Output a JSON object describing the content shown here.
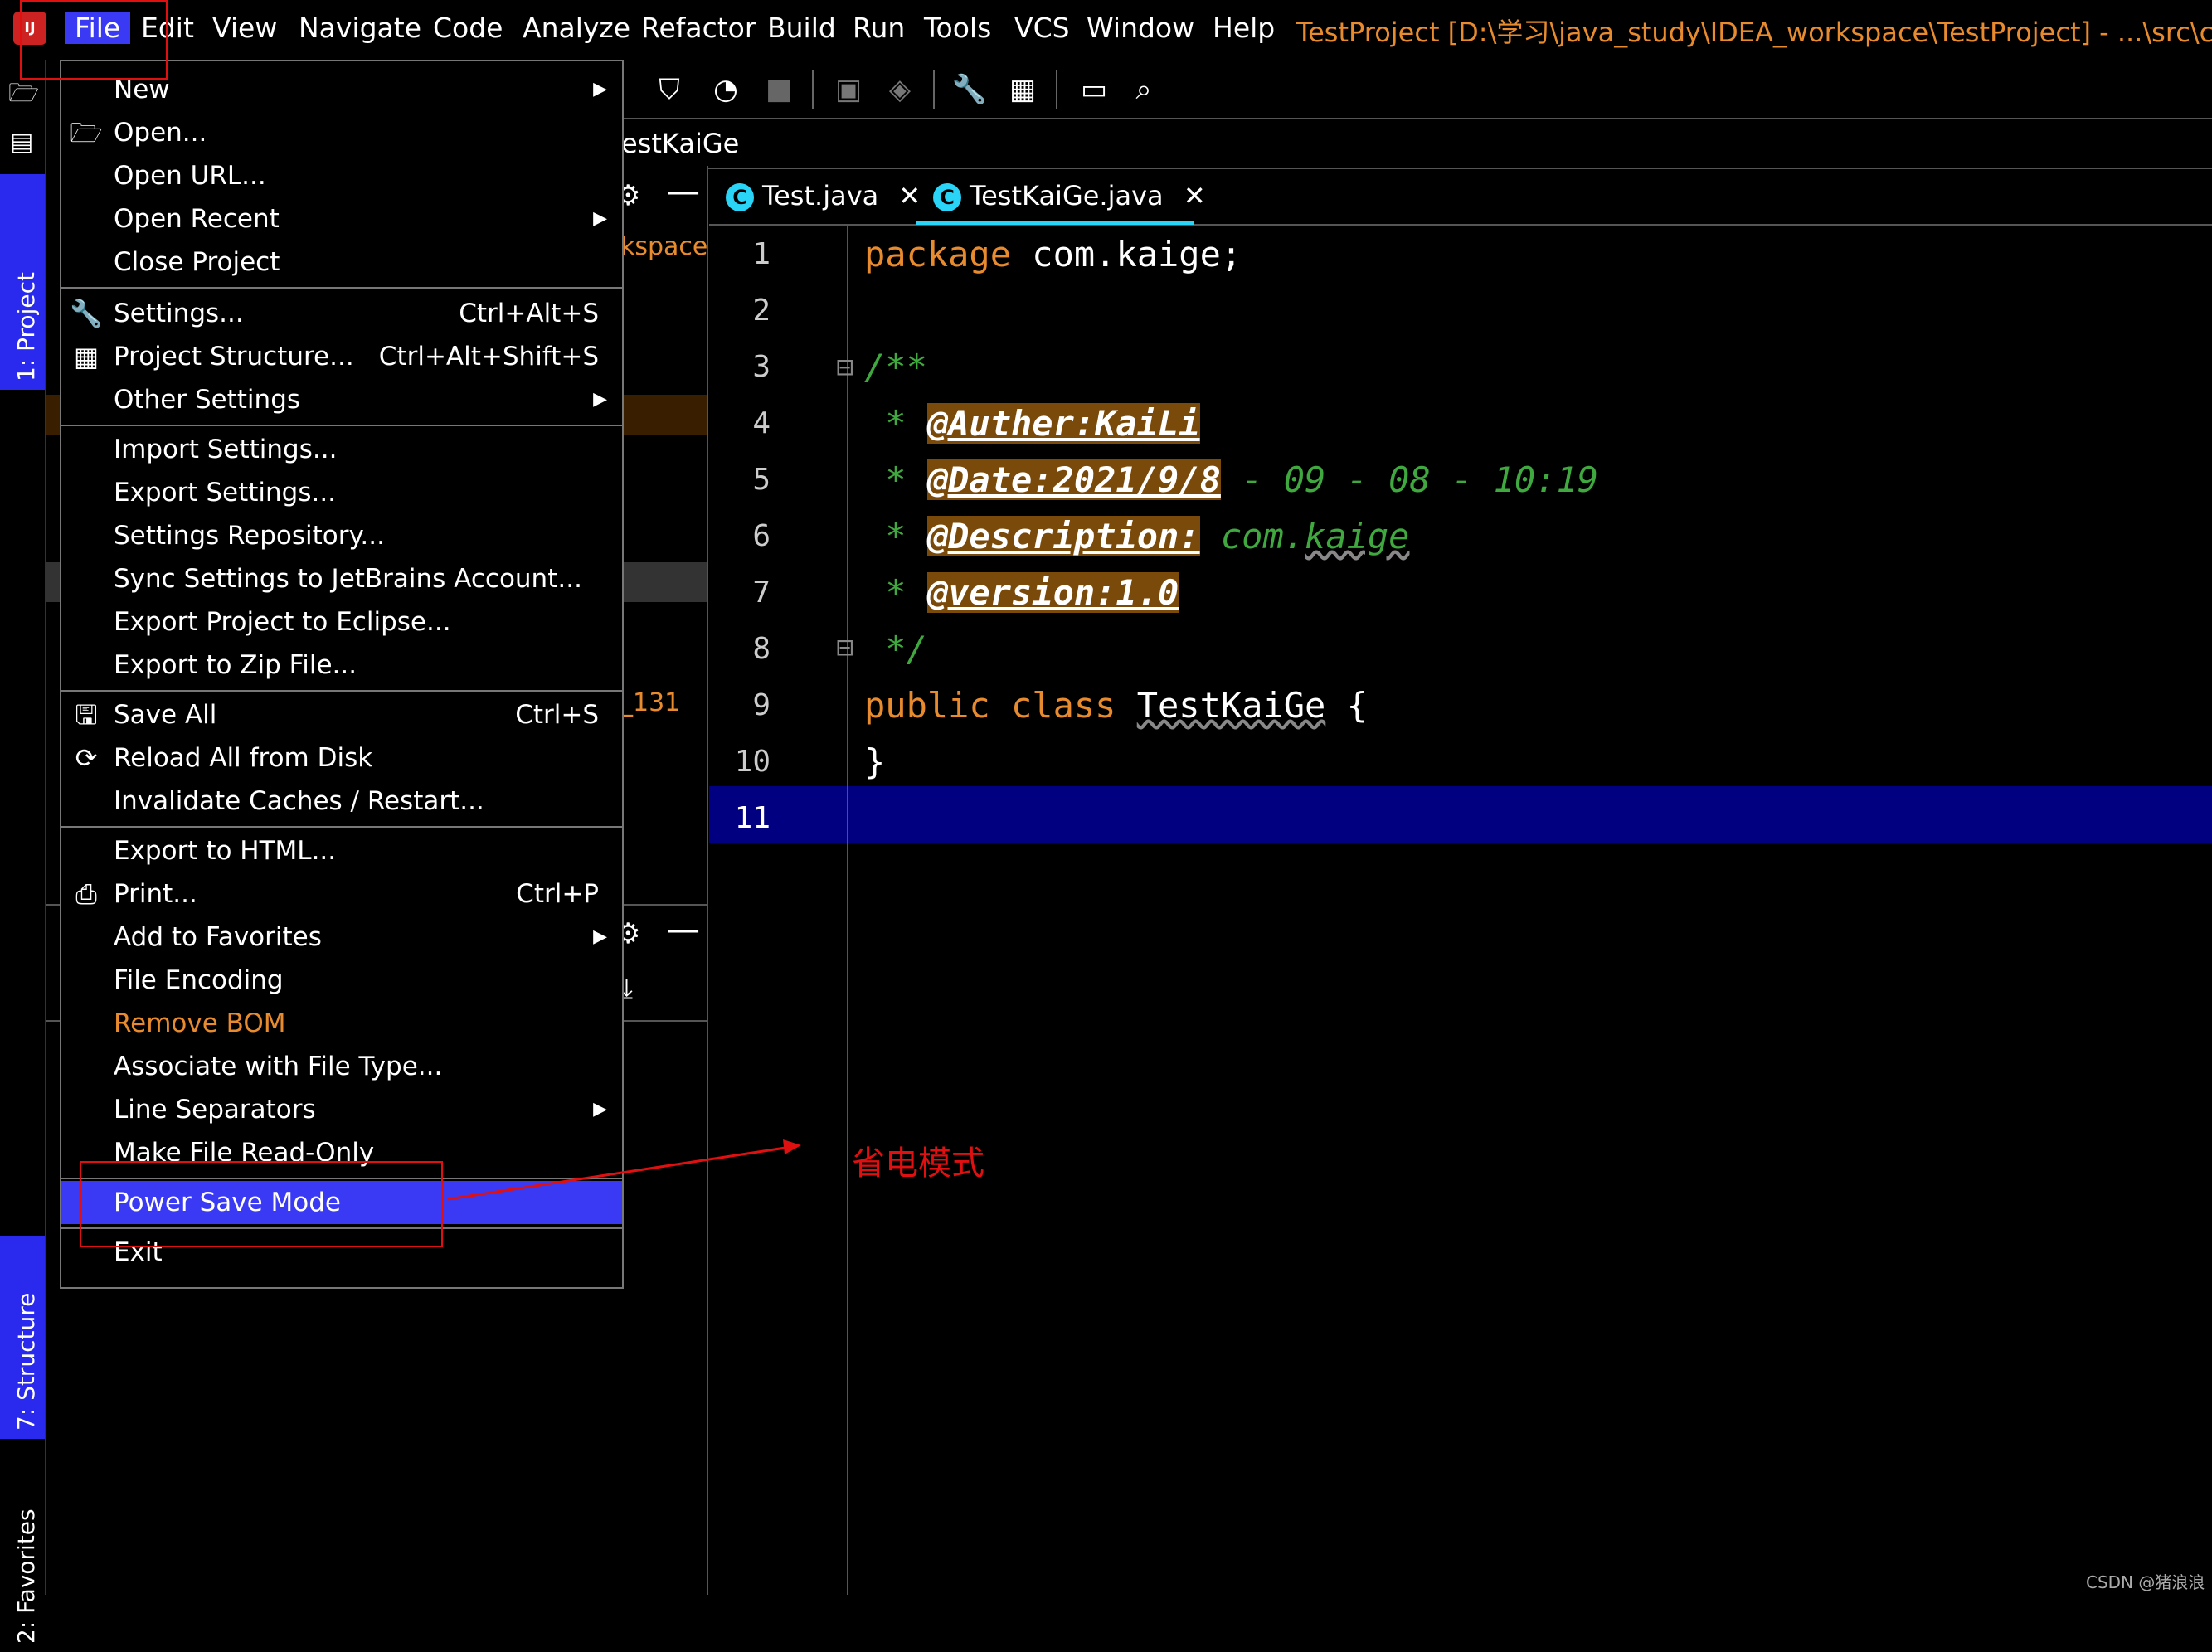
{
  "menubar": {
    "items": [
      "File",
      "Edit",
      "View",
      "Navigate",
      "Code",
      "Analyze",
      "Refactor",
      "Build",
      "Run",
      "Tools",
      "VCS",
      "Window",
      "Help"
    ],
    "title": "TestProject [D:\\学习\\java_study\\IDEA_workspace\\TestProject] - ...\\src\\com\\kai"
  },
  "breadcrumb": "estKaiGe",
  "left_strip": {
    "project_tab": "1: Project",
    "structure_tab": "7: Structure",
    "favorites_tab": "2: Favorites"
  },
  "project_panel": {
    "fragment_workspace": "kspace",
    "fragment_131": "_131"
  },
  "tabs": [
    {
      "label": "Test.java",
      "close": "✕"
    },
    {
      "label": "TestKaiGe.java",
      "close": "✕"
    }
  ],
  "editor": {
    "line_numbers": [
      "1",
      "2",
      "3",
      "4",
      "5",
      "6",
      "7",
      "8",
      "9",
      "10",
      "11"
    ],
    "line1": {
      "kw": "package",
      "rest": " com.kaige;"
    },
    "line3": "/**",
    "line4": {
      "star": " * ",
      "tag": "@Auther:KaiLi"
    },
    "line5": {
      "star": " * ",
      "tag": "@Date:2021/9/8",
      "rest": " - 09 - 08 - 10:19"
    },
    "line6": {
      "star": " * ",
      "tag": "@Description:",
      "rest": " com.",
      "squig": "kaige"
    },
    "line7": {
      "star": " * ",
      "tag": "@version:1.0"
    },
    "line8": " */",
    "line9": {
      "kw": "public class ",
      "name": "TestKaiGe",
      "rest": " {"
    },
    "line10": "}"
  },
  "file_menu": {
    "new": "New",
    "open": "Open...",
    "open_url": "Open URL...",
    "open_recent": "Open Recent",
    "close_project": "Close Project",
    "settings": "Settings...",
    "settings_sc": "Ctrl+Alt+S",
    "project_structure": "Project Structure...",
    "project_structure_sc": "Ctrl+Alt+Shift+S",
    "other_settings": "Other Settings",
    "import_settings": "Import Settings...",
    "export_settings": "Export Settings...",
    "settings_repo": "Settings Repository...",
    "sync_settings": "Sync Settings to JetBrains Account...",
    "export_eclipse": "Export Project to Eclipse...",
    "export_zip": "Export to Zip File...",
    "save_all": "Save All",
    "save_all_sc": "Ctrl+S",
    "reload": "Reload All from Disk",
    "invalidate": "Invalidate Caches / Restart...",
    "export_html": "Export to HTML...",
    "print": "Print...",
    "print_sc": "Ctrl+P",
    "add_favorites": "Add to Favorites",
    "file_encoding": "File Encoding",
    "remove_bom": "Remove BOM",
    "associate": "Associate with File Type...",
    "line_sep": "Line Separators",
    "make_readonly": "Make File Read-Only",
    "power_save": "Power Save Mode",
    "exit": "Exit"
  },
  "annotation": "省电模式",
  "watermark": "CSDN @猪浪浪",
  "colors": {
    "menu_highlight": "#3a3af5",
    "keyword": "#e88a2e",
    "comment": "#3fa83f",
    "annotation_red": "#e01010",
    "current_line": "#000080"
  }
}
